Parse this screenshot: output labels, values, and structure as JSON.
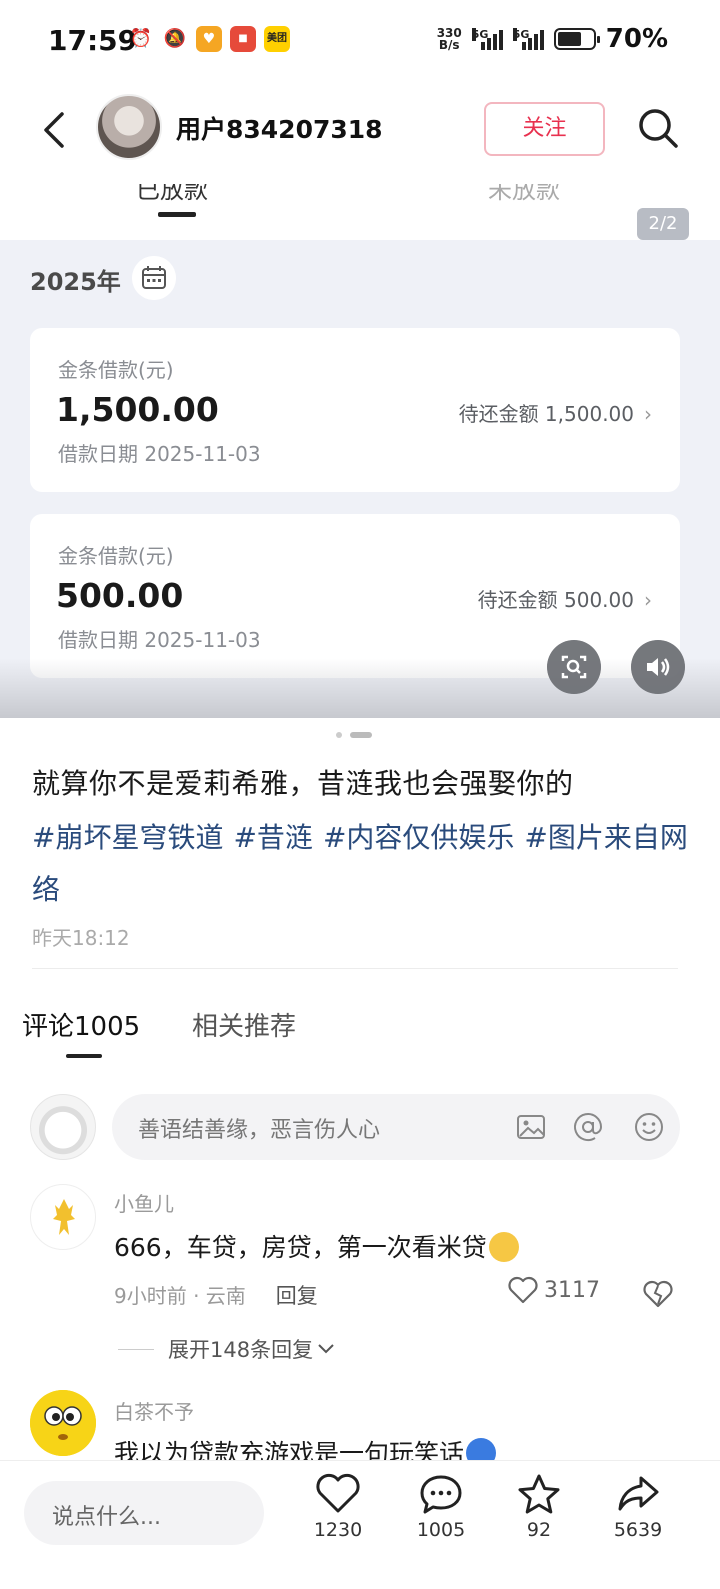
{
  "status_bar": {
    "time": "17:59",
    "net_speed_value": "330",
    "net_speed_unit": "B/s",
    "signal1_label": "5G",
    "signal2_label": "5G",
    "battery_pct": "70%",
    "battery_level": 0.7,
    "app3_label": "美团"
  },
  "header": {
    "username": "用户834207318",
    "follow_label": "关注"
  },
  "screenshot": {
    "tab_active": "已放款",
    "tab_inactive": "未放款",
    "page_indicator": "2/2",
    "year": "2025年",
    "loans": [
      {
        "type": "金条借款(元)",
        "amount": "1,500.00",
        "date": "借款日期 2025-11-03",
        "pending": "待还金额 1,500.00"
      },
      {
        "type": "金条借款(元)",
        "amount": "500.00",
        "date": "借款日期 2025-11-03",
        "pending": "待还金额 500.00"
      }
    ]
  },
  "post": {
    "title": "就算你不是爱莉希雅，昔涟我也会强娶你的",
    "tags": [
      "#崩坏星穹铁道",
      "#昔涟",
      "#内容仅供娱乐",
      "#图片来自网络"
    ],
    "time": "昨天18:12"
  },
  "comment_tabs": {
    "comments": "评论1005",
    "related": "相关推荐"
  },
  "comment_input": {
    "placeholder": "善语结善缘，恶言伤人心"
  },
  "comments": [
    {
      "name": "小鱼儿",
      "text": "666，车贷，房贷，第一次看米贷",
      "meta": "9小时前 · 云南",
      "reply": "回复",
      "likes": "3117",
      "expand": "展开148条回复"
    },
    {
      "name": "白茶不予",
      "text": "我以为贷款充游戏是一句玩笑话"
    }
  ],
  "bottom_bar": {
    "say_placeholder": "说点什么...",
    "likes": "1230",
    "comments": "1005",
    "favorites": "92",
    "shares": "5639"
  },
  "colors": {
    "accent": "#e8314f",
    "tag": "#2a4b7c"
  }
}
